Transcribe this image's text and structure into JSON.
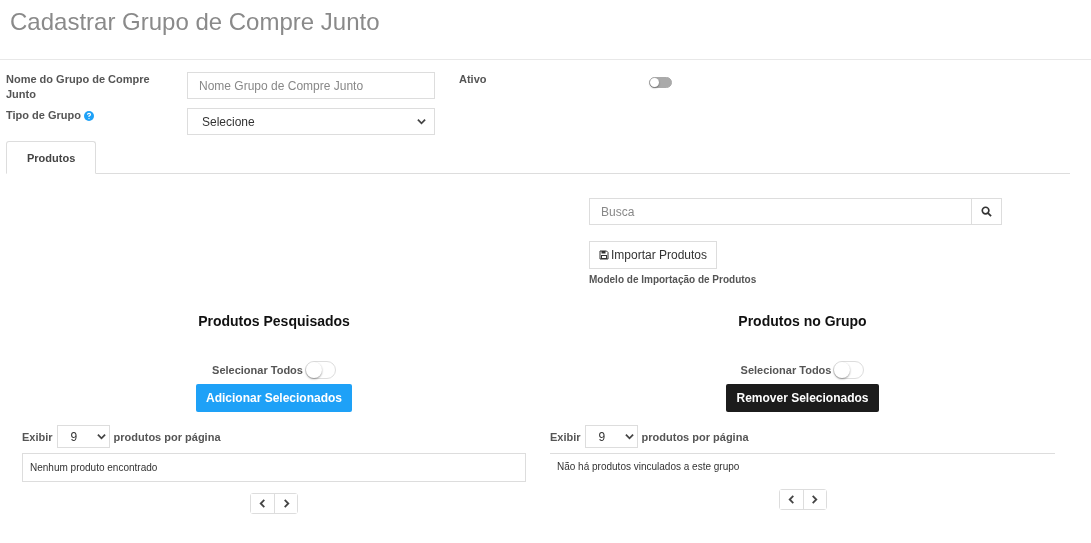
{
  "page": {
    "title": "Cadastrar Grupo de Compre Junto"
  },
  "form": {
    "name_label": "Nome do Grupo de Compre Junto",
    "name_placeholder": "Nome Grupo de Compre Junto",
    "type_label": "Tipo de Grupo",
    "type_value": "Selecione",
    "active_label": "Ativo",
    "active_on": false
  },
  "tabs": [
    {
      "label": "Produtos",
      "selected": true
    }
  ],
  "search": {
    "placeholder": "Busca"
  },
  "import": {
    "button": "Importar Produtos",
    "link": "Modelo de Importação de Produtos"
  },
  "panels": [
    {
      "title": "Produtos Pesquisados",
      "select_all_label": "Selecionar Todos",
      "select_all_on": false,
      "button": {
        "label": "Adicionar Selecionados",
        "kind": "primary"
      },
      "show_label": "Exibir",
      "page_size": "9",
      "per_page_label": "produtos por página",
      "empty": {
        "text": "Nenhum produto encontrado",
        "kind": "boxed"
      }
    },
    {
      "title": "Produtos no Grupo",
      "select_all_label": "Selecionar Todos",
      "select_all_on": false,
      "button": {
        "label": "Remover Selecionados",
        "kind": "dark"
      },
      "show_label": "Exibir",
      "page_size": "9",
      "per_page_label": "produtos por página",
      "empty": {
        "text": "Não há produtos vinculados a este grupo",
        "kind": "ruled"
      }
    }
  ]
}
